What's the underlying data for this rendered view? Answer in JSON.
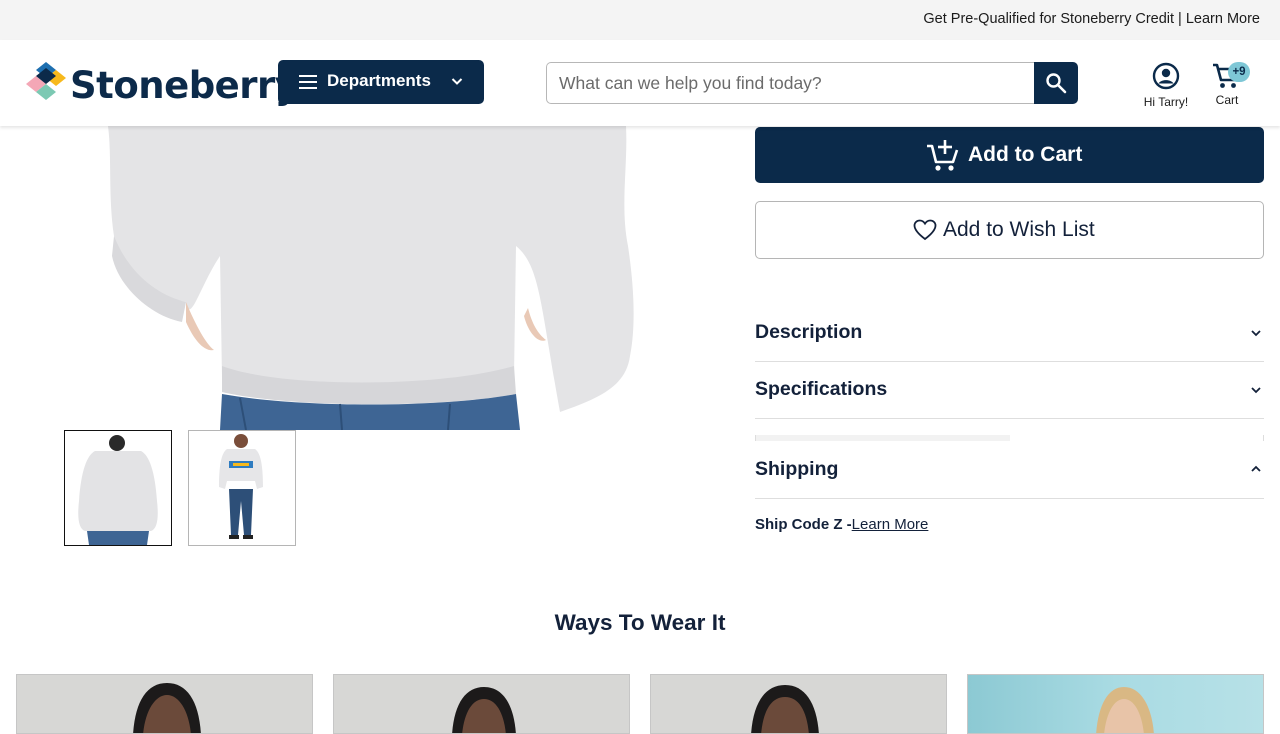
{
  "promo": {
    "text": "Get Pre-Qualified for Stoneberry Credit | Learn More"
  },
  "header": {
    "logo_text": "Stoneberry",
    "departments_label": "Departments",
    "search_placeholder": "What can we help you find today?",
    "account_label": "Hi Tarry!",
    "cart_label": "Cart",
    "cart_badge": "+9"
  },
  "product": {
    "add_to_cart_label": "Add to Cart",
    "wish_list_label": "Add to Wish List",
    "accordion": [
      {
        "title": "Description",
        "state": "collapsed"
      },
      {
        "title": "Specifications",
        "state": "collapsed"
      },
      {
        "title": "Shipping",
        "state": "expanded"
      }
    ],
    "shipping": {
      "code_label": "Ship Code Z -",
      "link_label": "Learn More"
    }
  },
  "wear": {
    "title": "Ways To Wear It"
  },
  "colors": {
    "brand_navy": "#0b2a4a",
    "badge": "#7ec7d6",
    "promo_bg": "#f4f4f4"
  },
  "icons": [
    "hamburger-icon",
    "chevron-down-icon",
    "search-icon",
    "account-icon",
    "cart-icon",
    "add-cart-icon",
    "heart-icon",
    "chevron-up-icon"
  ]
}
